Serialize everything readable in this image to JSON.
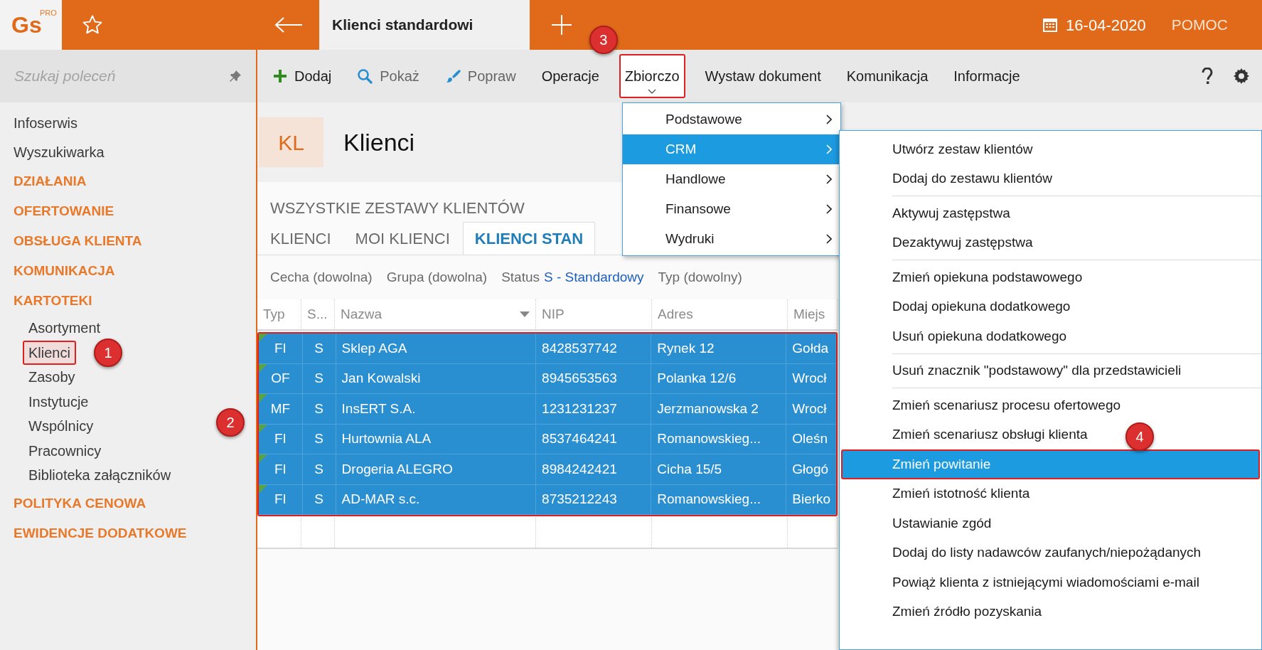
{
  "app": {
    "logo": "Gs",
    "logo_badge": "PRO"
  },
  "top_bar": {
    "tab_title": "Klienci standardowi",
    "date": "16-04-2020",
    "help": "POMOC"
  },
  "sidebar": {
    "search_placeholder": "Szukaj poleceń",
    "items": [
      {
        "label": "Infoserwis",
        "kind": "link"
      },
      {
        "label": "Wyszukiwarka",
        "kind": "link"
      },
      {
        "label": "DZIAŁANIA",
        "kind": "section"
      },
      {
        "label": "OFERTOWANIE",
        "kind": "section"
      },
      {
        "label": "OBSŁUGA KLIENTA",
        "kind": "section"
      },
      {
        "label": "KOMUNIKACJA",
        "kind": "section"
      },
      {
        "label": "KARTOTEKI",
        "kind": "section",
        "children": [
          {
            "label": "Asortyment",
            "highlighted": false
          },
          {
            "label": "Klienci",
            "highlighted": true,
            "badge": "1"
          },
          {
            "label": "Zasoby",
            "highlighted": false
          },
          {
            "label": "Instytucje",
            "highlighted": false
          },
          {
            "label": "Wspólnicy",
            "highlighted": false
          },
          {
            "label": "Pracownicy",
            "highlighted": false
          },
          {
            "label": "Biblioteka załączników",
            "highlighted": false
          }
        ]
      },
      {
        "label": "POLITYKA CENOWA",
        "kind": "section"
      },
      {
        "label": "EWIDENCJE DODATKOWE",
        "kind": "section"
      }
    ]
  },
  "toolbar": {
    "items": [
      {
        "label": "Dodaj",
        "kind": "add",
        "disabled": false,
        "highlighted": false
      },
      {
        "label": "Pokaż",
        "kind": "show",
        "disabled": true,
        "highlighted": false
      },
      {
        "label": "Popraw",
        "kind": "edit",
        "disabled": true,
        "highlighted": false
      },
      {
        "label": "Operacje",
        "kind": "text",
        "disabled": false,
        "highlighted": false
      },
      {
        "label": "Zbiorczo",
        "kind": "dropdown",
        "disabled": false,
        "highlighted": true,
        "badge": "3"
      },
      {
        "label": "Wystaw dokument",
        "kind": "text",
        "disabled": false,
        "highlighted": false
      },
      {
        "label": "Komunikacja",
        "kind": "text",
        "disabled": false,
        "highlighted": false
      },
      {
        "label": "Informacje",
        "kind": "text",
        "disabled": false,
        "highlighted": false
      }
    ]
  },
  "header": {
    "code": "KL",
    "title": "Klienci",
    "subtitle": "WSZYSTKIE ZESTAWY KLIENTÓW"
  },
  "tabs": [
    {
      "label": "KLIENCI",
      "selected": false
    },
    {
      "label": "MOI KLIENCI",
      "selected": false
    },
    {
      "label": "KLIENCI STAN",
      "selected": true
    }
  ],
  "filters": [
    {
      "label": "Cecha (dowolna)"
    },
    {
      "label": "Grupa (dowolna)"
    },
    {
      "label": "Status",
      "value": "S - Standardowy"
    },
    {
      "label": "Typ (dowolny)"
    }
  ],
  "table": {
    "badge": "2",
    "highlighted": true,
    "columns": [
      "Typ",
      "S...",
      "Nazwa",
      "NIP",
      "Adres",
      "Miejs"
    ],
    "rows": [
      {
        "selected": true,
        "cells": [
          "FI",
          "S",
          "Sklep AGA",
          "8428537742",
          "Rynek 12",
          "Gołda"
        ]
      },
      {
        "selected": true,
        "cells": [
          "OF",
          "S",
          "Jan Kowalski",
          "8945653563",
          "Polanka  12/6",
          "Wrocł"
        ]
      },
      {
        "selected": true,
        "cells": [
          "MF",
          "S",
          "InsERT S.A.",
          "1231231237",
          "Jerzmanowska 2",
          "Wrocł"
        ]
      },
      {
        "selected": true,
        "cells": [
          "FI",
          "S",
          "Hurtownia ALA",
          "8537464241",
          "Romanowskieg...",
          "Oleśn"
        ]
      },
      {
        "selected": true,
        "cells": [
          "FI",
          "S",
          "Drogeria ALEGRO",
          "8984242421",
          "Cicha  15/5",
          "Głogó"
        ]
      },
      {
        "selected": true,
        "cells": [
          "FI",
          "S",
          "AD-MAR s.c.",
          "8735212243",
          "Romanowskieg...",
          "Bierko"
        ]
      }
    ]
  },
  "menu": {
    "items": [
      {
        "label": "Podstawowe",
        "selected": false
      },
      {
        "label": "CRM",
        "selected": true
      },
      {
        "label": "Handlowe",
        "selected": false
      },
      {
        "label": "Finansowe",
        "selected": false
      },
      {
        "label": "Wydruki",
        "selected": false
      }
    ]
  },
  "submenu": {
    "groups": [
      [
        {
          "label": "Utwórz zestaw klientów",
          "selected": false
        },
        {
          "label": "Dodaj do zestawu klientów",
          "selected": false
        }
      ],
      [
        {
          "label": "Aktywuj zastępstwa",
          "selected": false
        },
        {
          "label": "Dezaktywuj zastępstwa",
          "selected": false
        }
      ],
      [
        {
          "label": "Zmień opiekuna podstawowego",
          "selected": false
        },
        {
          "label": "Dodaj opiekuna dodatkowego",
          "selected": false
        },
        {
          "label": "Usuń opiekuna dodatkowego",
          "selected": false
        }
      ],
      [
        {
          "label": "Usuń znacznik \"podstawowy\" dla przedstawicieli",
          "selected": false
        }
      ],
      [
        {
          "label": "Zmień scenariusz procesu ofertowego",
          "selected": false
        },
        {
          "label": "Zmień scenariusz obsługi klienta",
          "selected": false
        },
        {
          "label": "Zmień powitanie",
          "selected": true,
          "badge": "4"
        },
        {
          "label": "Zmień istotność klienta",
          "selected": false
        },
        {
          "label": "Ustawianie zgód",
          "selected": false
        },
        {
          "label": "Dodaj do listy nadawców zaufanych/niepożądanych",
          "selected": false
        },
        {
          "label": "Powiąż klienta z istniejącymi wiadomościami e-mail",
          "selected": false
        },
        {
          "label": "Zmień źródło pozyskania",
          "selected": false
        }
      ]
    ]
  }
}
